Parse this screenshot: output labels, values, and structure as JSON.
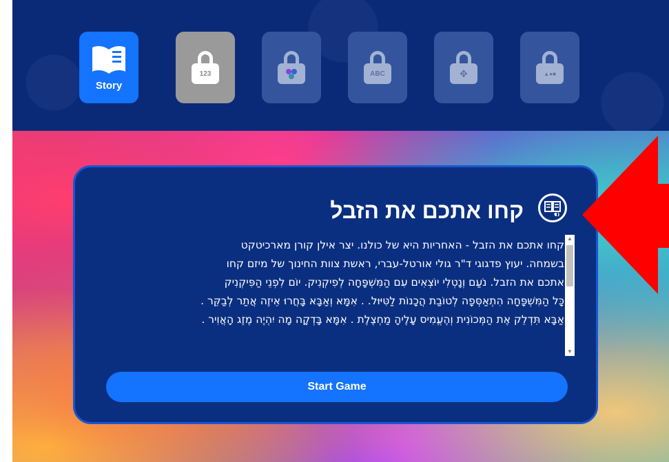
{
  "tabs": [
    {
      "label": "Story",
      "icon": "book-icon",
      "state": "active"
    },
    {
      "glyph": "123",
      "icon": "lock-icon",
      "state": "locked"
    },
    {
      "glyph": "",
      "icon": "lock-colors-icon",
      "state": "locked"
    },
    {
      "glyph": "ABC",
      "icon": "lock-icon",
      "state": "locked"
    },
    {
      "glyph": "✥",
      "icon": "lock-move-icon",
      "state": "locked"
    },
    {
      "glyph": "▲●■",
      "icon": "lock-shapes-icon",
      "state": "locked"
    }
  ],
  "story_card": {
    "title": "קחו אתכם את הזבל",
    "read_aloud_icon": "book-audio-icon",
    "lines": [
      "קחו אתכם את הזבל - האחריות היא של כולנו. יצר אילן קורן מארכיטקט",
      "בשמחה. יעוץ פדגוגי ד\"ר גולי אורטל-עברי, ראשת צוות החינוך של מיזם קחו",
      "אתכם את הזבל.   נֹעַם וְנָטְלִי יוֹצְאִים עִם הַמִּשְׁפָּחָה לְפִיקְנִיק.  יוֹם לִפְנֵי הַפִּיקְנִיק",
      "כָּל הַמִּשְׁפָּחָה הִתְאַסְּפָה לְטוֹבַת הֲכָנוֹת לַטִּיּוּל.  . אִמָּא וְאַבָּא בָּחֲרוּ אֵיזֶה אֲתַר לְבַקֵּר .",
      "אַבָּא תִּדְלֵק אֶת הַמְּכוֹנִית וְהֶעֱמִיס עָלֶיהָ מַחְצֶלֶת . אִמָּא בָּדְקָה מָה יִהְיֶה מֶזֶג הָאֲוִיר ."
    ],
    "start_button": "Start Game"
  },
  "colors": {
    "topbar": "#0a2a78",
    "active_tab": "#1473ff",
    "card": "#0b2f80",
    "card_border": "#1b55d2",
    "annotation_arrow": "#ff0000"
  }
}
